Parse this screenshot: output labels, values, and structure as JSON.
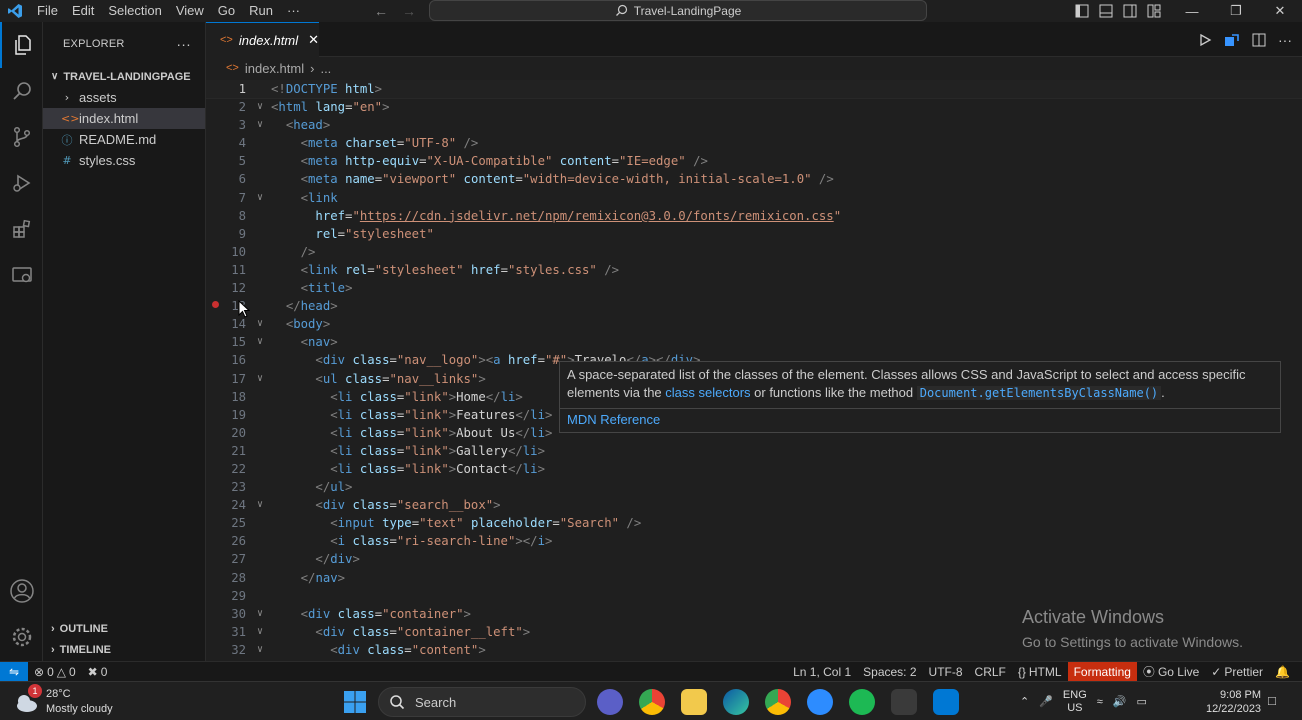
{
  "titlebar": {
    "menu": [
      "File",
      "Edit",
      "Selection",
      "View",
      "Go",
      "Run",
      "···"
    ],
    "search_text": "Travel-LandingPage"
  },
  "sidebar": {
    "title": "EXPLORER",
    "more": "···",
    "project": "TRAVEL-LANDINGPAGE",
    "items": [
      {
        "name": "assets",
        "kind": "folder"
      },
      {
        "name": "index.html",
        "kind": "html"
      },
      {
        "name": "README.md",
        "kind": "info"
      },
      {
        "name": "styles.css",
        "kind": "css"
      }
    ],
    "outline": "OUTLINE",
    "timeline": "TIMELINE"
  },
  "editor": {
    "tab": "index.html",
    "breadcrumb_file": "index.html",
    "breadcrumb_more": "..."
  },
  "hover": {
    "text1": "A space-separated list of the classes of the element. Classes allows CSS and JavaScript to select and access specific",
    "text2a": "elements via the ",
    "link": "class selectors",
    "text2b": " or functions like the method ",
    "code": "Document.getElementsByClassName()",
    "text2c": ".",
    "ref": "MDN Reference"
  },
  "activate": {
    "title": "Activate Windows",
    "sub": "Go to Settings to activate Windows."
  },
  "status": {
    "errors": "0",
    "warnings": "0",
    "ports": "0",
    "position": "Ln 1, Col 1",
    "spaces": "Spaces: 2",
    "encoding": "UTF-8",
    "eol": "CRLF",
    "language": "HTML",
    "formatting": "Formatting",
    "golive": "Go Live",
    "prettier": "Prettier"
  },
  "taskbar": {
    "temp": "28°C",
    "weather": "Mostly cloudy",
    "badge": "1",
    "search": "Search",
    "lang1": "ENG",
    "lang2": "US",
    "time": "9:08 PM",
    "date": "12/22/2023"
  },
  "code_lines": [
    {
      "n": "1",
      "f": "",
      "h": "<span class='t'>&lt;!</span><span class='tn'>DOCTYPE</span> <span class='at'>html</span><span class='t'>&gt;</span>"
    },
    {
      "n": "2",
      "f": "v",
      "h": "<span class='t'>&lt;</span><span class='tn'>html</span> <span class='at'>lang</span>=<span class='sv'>\"en\"</span><span class='t'>&gt;</span>"
    },
    {
      "n": "3",
      "f": "v",
      "h": "  <span class='t'>&lt;</span><span class='tn'>head</span><span class='t'>&gt;</span>"
    },
    {
      "n": "4",
      "f": "",
      "h": "    <span class='t'>&lt;</span><span class='tn'>meta</span> <span class='at'>charset</span>=<span class='sv'>\"UTF-8\"</span> <span class='t'>/&gt;</span>"
    },
    {
      "n": "5",
      "f": "",
      "h": "    <span class='t'>&lt;</span><span class='tn'>meta</span> <span class='at'>http-equiv</span>=<span class='sv'>\"X-UA-Compatible\"</span> <span class='at'>content</span>=<span class='sv'>\"IE=edge\"</span> <span class='t'>/&gt;</span>"
    },
    {
      "n": "6",
      "f": "",
      "h": "    <span class='t'>&lt;</span><span class='tn'>meta</span> <span class='at'>name</span>=<span class='sv'>\"viewport\"</span> <span class='at'>content</span>=<span class='sv'>\"width=device-width, initial-scale=1.0\"</span> <span class='t'>/&gt;</span>"
    },
    {
      "n": "7",
      "f": "v",
      "h": "    <span class='t'>&lt;</span><span class='tn'>link</span>"
    },
    {
      "n": "8",
      "f": "",
      "h": "      <span class='at'>href</span>=<span class='sv'>\"</span><span class='url'>https://cdn.jsdelivr.net/npm/remixicon@3.0.0/fonts/remixicon.css</span><span class='sv'>\"</span>"
    },
    {
      "n": "9",
      "f": "",
      "h": "      <span class='at'>rel</span>=<span class='sv'>\"stylesheet\"</span>"
    },
    {
      "n": "10",
      "f": "",
      "h": "    <span class='t'>/&gt;</span>"
    },
    {
      "n": "11",
      "f": "",
      "h": "    <span class='t'>&lt;</span><span class='tn'>link</span> <span class='at'>rel</span>=<span class='sv'>\"stylesheet\"</span> <span class='at'>href</span>=<span class='sv'>\"styles.css\"</span> <span class='t'>/&gt;</span>"
    },
    {
      "n": "12",
      "f": "",
      "h": "    <span class='t'>&lt;</span><span class='tn'>title</span><span class='t'>&gt;</span>"
    },
    {
      "n": "13",
      "f": "",
      "h": "  <span class='t'>&lt;/</span><span class='tn'>head</span><span class='t'>&gt;</span>"
    },
    {
      "n": "14",
      "f": "v",
      "h": "  <span class='t'>&lt;</span><span class='tn'>body</span><span class='t'>&gt;</span>"
    },
    {
      "n": "15",
      "f": "v",
      "h": "    <span class='t'>&lt;</span><span class='tn'>nav</span><span class='t'>&gt;</span>"
    },
    {
      "n": "16",
      "f": "",
      "h": "      <span class='t'>&lt;</span><span class='tn'>div</span> <span class='at'>class</span>=<span class='sv'>\"nav__logo\"</span><span class='t'>&gt;&lt;</span><span class='tn'>a</span> <span class='at'>href</span>=<span class='sv'>\"#\"</span><span class='t'>&gt;</span><span class='tx'>Travelo</span><span class='t'>&lt;/</span><span class='tn'>a</span><span class='t'>&gt;&lt;/</span><span class='tn'>div</span><span class='t'>&gt;</span>"
    },
    {
      "n": "17",
      "f": "v",
      "h": "      <span class='t'>&lt;</span><span class='tn'>ul</span> <span class='at'>class</span>=<span class='sv'>\"nav__links\"</span><span class='t'>&gt;</span>"
    },
    {
      "n": "18",
      "f": "",
      "h": "        <span class='t'>&lt;</span><span class='tn'>li</span> <span class='at'>class</span>=<span class='sv'>\"link\"</span><span class='t'>&gt;</span><span class='tx'>Home</span><span class='t'>&lt;/</span><span class='tn'>li</span><span class='t'>&gt;</span>"
    },
    {
      "n": "19",
      "f": "",
      "h": "        <span class='t'>&lt;</span><span class='tn'>li</span> <span class='at'>class</span>=<span class='sv'>\"link\"</span><span class='t'>&gt;</span><span class='tx'>Features</span><span class='t'>&lt;/</span><span class='tn'>li</span><span class='t'>&gt;</span>"
    },
    {
      "n": "20",
      "f": "",
      "h": "        <span class='t'>&lt;</span><span class='tn'>li</span> <span class='at'>class</span>=<span class='sv'>\"link\"</span><span class='t'>&gt;</span><span class='tx'>About Us</span><span class='t'>&lt;/</span><span class='tn'>li</span><span class='t'>&gt;</span>"
    },
    {
      "n": "21",
      "f": "",
      "h": "        <span class='t'>&lt;</span><span class='tn'>li</span> <span class='at'>class</span>=<span class='sv'>\"link\"</span><span class='t'>&gt;</span><span class='tx'>Gallery</span><span class='t'>&lt;/</span><span class='tn'>li</span><span class='t'>&gt;</span>"
    },
    {
      "n": "22",
      "f": "",
      "h": "        <span class='t'>&lt;</span><span class='tn'>li</span> <span class='at'>class</span>=<span class='sv'>\"link\"</span><span class='t'>&gt;</span><span class='tx'>Contact</span><span class='t'>&lt;/</span><span class='tn'>li</span><span class='t'>&gt;</span>"
    },
    {
      "n": "23",
      "f": "",
      "h": "      <span class='t'>&lt;/</span><span class='tn'>ul</span><span class='t'>&gt;</span>"
    },
    {
      "n": "24",
      "f": "v",
      "h": "      <span class='t'>&lt;</span><span class='tn'>div</span> <span class='at'>class</span>=<span class='sv'>\"search__box\"</span><span class='t'>&gt;</span>"
    },
    {
      "n": "25",
      "f": "",
      "h": "        <span class='t'>&lt;</span><span class='tn'>input</span> <span class='at'>type</span>=<span class='sv'>\"text\"</span> <span class='at'>placeholder</span>=<span class='sv'>\"Search\"</span> <span class='t'>/&gt;</span>"
    },
    {
      "n": "26",
      "f": "",
      "h": "        <span class='t'>&lt;</span><span class='tn'>i</span> <span class='at'>class</span>=<span class='sv'>\"ri-search-line\"</span><span class='t'>&gt;&lt;/</span><span class='tn'>i</span><span class='t'>&gt;</span>"
    },
    {
      "n": "27",
      "f": "",
      "h": "      <span class='t'>&lt;/</span><span class='tn'>div</span><span class='t'>&gt;</span>"
    },
    {
      "n": "28",
      "f": "",
      "h": "    <span class='t'>&lt;/</span><span class='tn'>nav</span><span class='t'>&gt;</span>"
    },
    {
      "n": "29",
      "f": "",
      "h": ""
    },
    {
      "n": "30",
      "f": "v",
      "h": "    <span class='t'>&lt;</span><span class='tn'>div</span> <span class='at'>class</span>=<span class='sv'>\"container\"</span><span class='t'>&gt;</span>"
    },
    {
      "n": "31",
      "f": "v",
      "h": "      <span class='t'>&lt;</span><span class='tn'>div</span> <span class='at'>class</span>=<span class='sv'>\"container__left\"</span><span class='t'>&gt;</span>"
    },
    {
      "n": "32",
      "f": "v",
      "h": "        <span class='t'>&lt;</span><span class='tn'>div</span> <span class='at'>class</span>=<span class='sv'>\"content\"</span><span class='t'>&gt;</span>"
    }
  ]
}
